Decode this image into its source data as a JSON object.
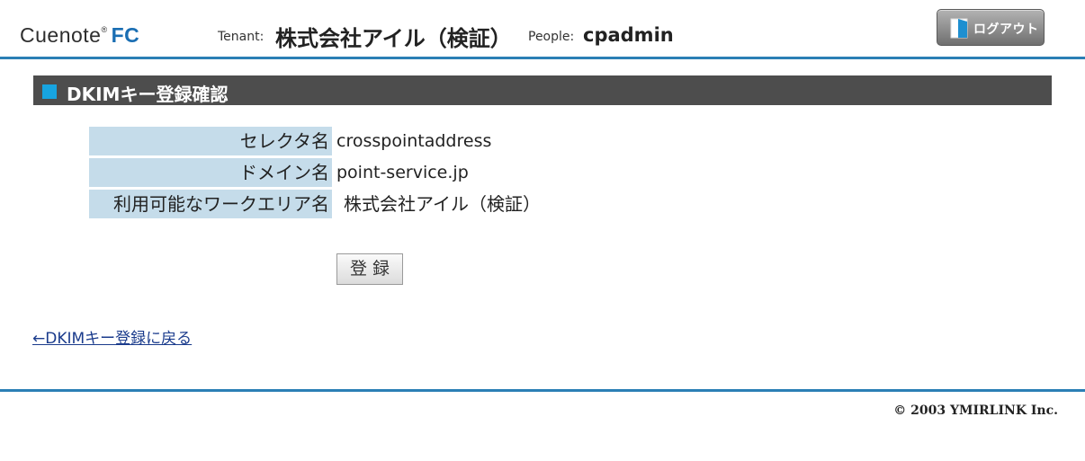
{
  "header": {
    "logo_main": "Cuenote",
    "logo_mark": "®",
    "logo_product": "FC",
    "tenant_label": "Tenant:",
    "tenant_name": "株式会社アイル（検証）",
    "people_label": "People:",
    "people_name": "cpadmin",
    "logout_label": "ログアウト",
    "logout_icon": "door-icon"
  },
  "section": {
    "title": "DKIMキー登録確認",
    "accent_color": "#17a4e0"
  },
  "form": {
    "rows": [
      {
        "label": "セレクタ名",
        "value": "crosspointaddress"
      },
      {
        "label": "ドメイン名",
        "value": "point-service.jp"
      },
      {
        "label": "利用可能なワークエリア名",
        "value": "株式会社アイル（検証）"
      }
    ],
    "submit_label": "登録"
  },
  "nav": {
    "back_link": "←DKIMキー登録に戻る"
  },
  "footer": {
    "copyright": "© 2003 YMIRLINK Inc."
  }
}
